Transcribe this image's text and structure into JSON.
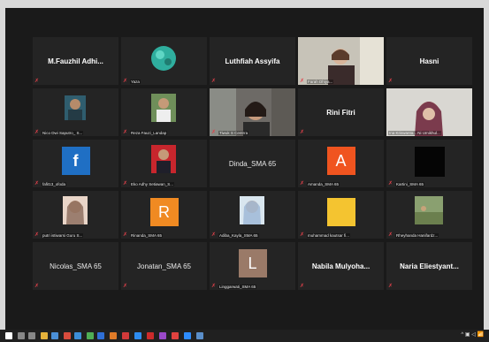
{
  "tiles": [
    {
      "type": "name",
      "name": "M.Fauzhil  Adhi...",
      "label": ""
    },
    {
      "type": "avatar",
      "name": "",
      "label": "Yaza"
    },
    {
      "type": "name",
      "name": "Luthfiah Assyifa",
      "label": ""
    },
    {
      "type": "video",
      "name": "",
      "label": "Farah Dhiya..."
    },
    {
      "type": "name",
      "name": "Hasni",
      "label": ""
    },
    {
      "type": "avatar",
      "name": "",
      "label": "Nico Dwi Saputro_ S..."
    },
    {
      "type": "avatar",
      "name": "",
      "label": "Reza Fauzi_Landap"
    },
    {
      "type": "video",
      "name": "",
      "label": "Tiwuk S Centrra"
    },
    {
      "type": "name",
      "name": "Rini Fitri",
      "label": ""
    },
    {
      "type": "video",
      "name": "",
      "label": "Ina Kriswanta... Ni Umikhul..."
    },
    {
      "type": "letter",
      "name": "f",
      "label": "fafit13_ofoda",
      "color": "#1f6fc4"
    },
    {
      "type": "avatar",
      "name": "",
      "label": "Eko Adhy Setiawan_S..."
    },
    {
      "type": "name",
      "name": "Dinda_SMA 65",
      "label": ""
    },
    {
      "type": "letter",
      "name": "A",
      "label": "Amanda_SMA 65",
      "color": "#f0541f"
    },
    {
      "type": "dark",
      "name": "",
      "label": "Kartini_SMA 65"
    },
    {
      "type": "avatar",
      "name": "",
      "label": "putri istiwarsi Guru S..."
    },
    {
      "type": "letter",
      "name": "R",
      "label": "Rinanda_SMA 65",
      "color": "#f08a22"
    },
    {
      "type": "avatar",
      "name": "",
      "label": "Adiba_Kayla_SMA 65"
    },
    {
      "type": "yellow",
      "name": "",
      "label": "muhammad kautsar fi..."
    },
    {
      "type": "avatar",
      "name": "",
      "label": "Rheyhanda Hanifardz..."
    },
    {
      "type": "name",
      "name": "Nicolas_SMA 65",
      "label": ""
    },
    {
      "type": "name",
      "name": "Jonatan_SMA 65",
      "label": ""
    },
    {
      "type": "letter",
      "name": "L",
      "label": "Linggarwati_SMA 65",
      "color": "#9a7a68"
    },
    {
      "type": "name",
      "name": "Nabila  Mulyoha...",
      "label": ""
    },
    {
      "type": "name",
      "name": "Naria  Eliestyant...",
      "label": ""
    }
  ],
  "taskbar": {
    "tray": "^ ▣ ◁ 📶"
  }
}
